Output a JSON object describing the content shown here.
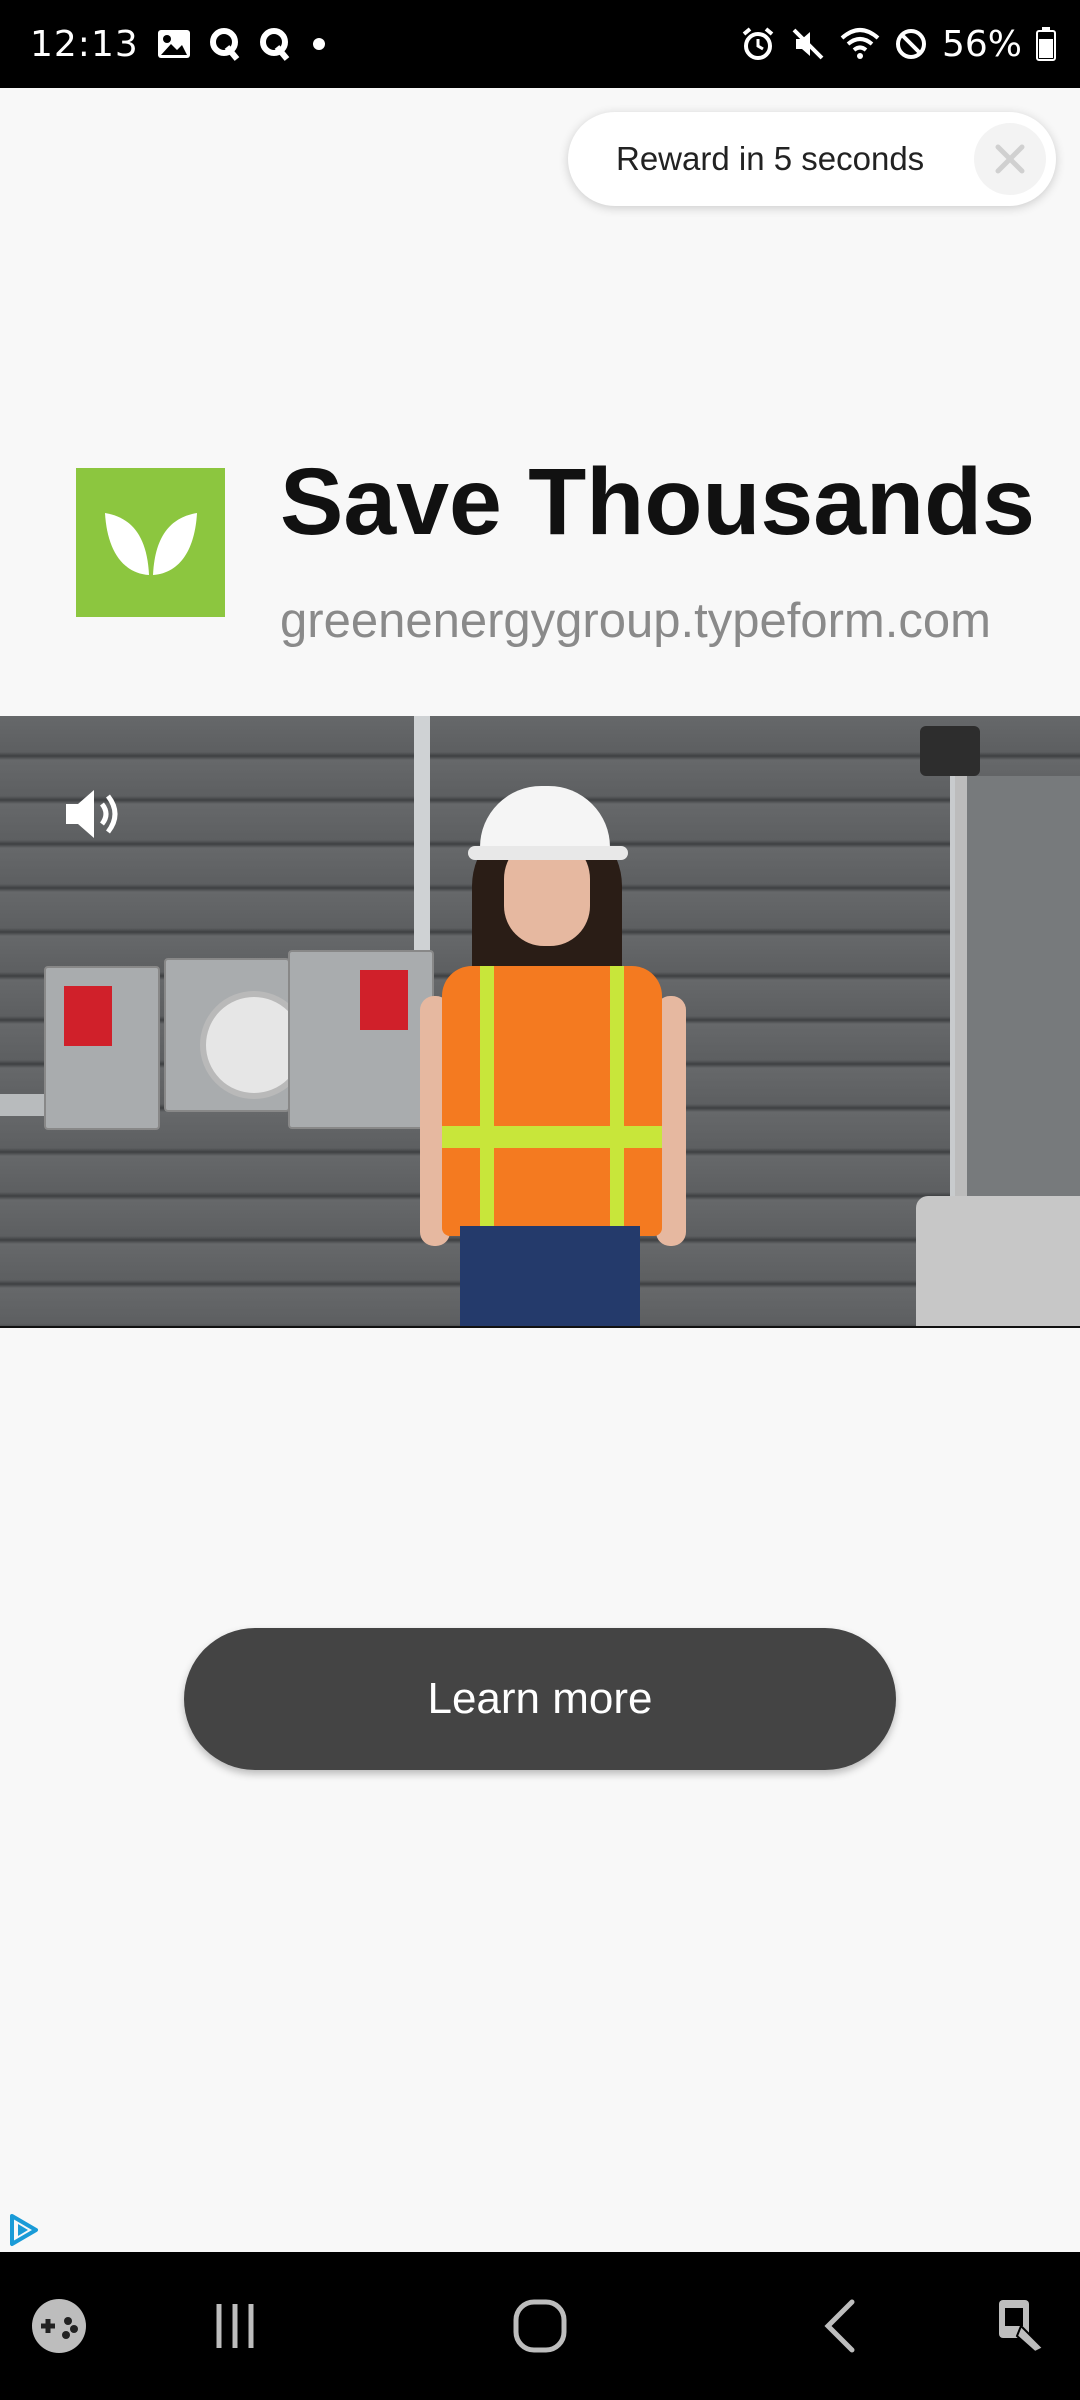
{
  "status_bar": {
    "time": "12:13",
    "battery_percent": "56%",
    "left_icons": [
      "gallery-icon",
      "q-app-icon",
      "q-app-icon",
      "dot-icon"
    ],
    "right_icons": [
      "alarm-icon",
      "mute-icon",
      "wifi-icon",
      "do-not-disturb-icon",
      "battery-icon"
    ]
  },
  "reward": {
    "text": "Reward in 5 seconds"
  },
  "ad": {
    "title": "Save Thousands",
    "domain": "greenenergygroup.typeform.com",
    "brand_color": "#8cc63f",
    "logo_icon": "leaf-icon"
  },
  "video": {
    "volume_icon": "volume-icon"
  },
  "cta": {
    "label": "Learn more",
    "color": "#444444"
  },
  "adchoices_icon": "adchoices-icon",
  "nav_bar": {
    "items": [
      "game-launcher-icon",
      "recent-apps-icon",
      "home-icon",
      "back-icon",
      "assistant-icon"
    ]
  }
}
